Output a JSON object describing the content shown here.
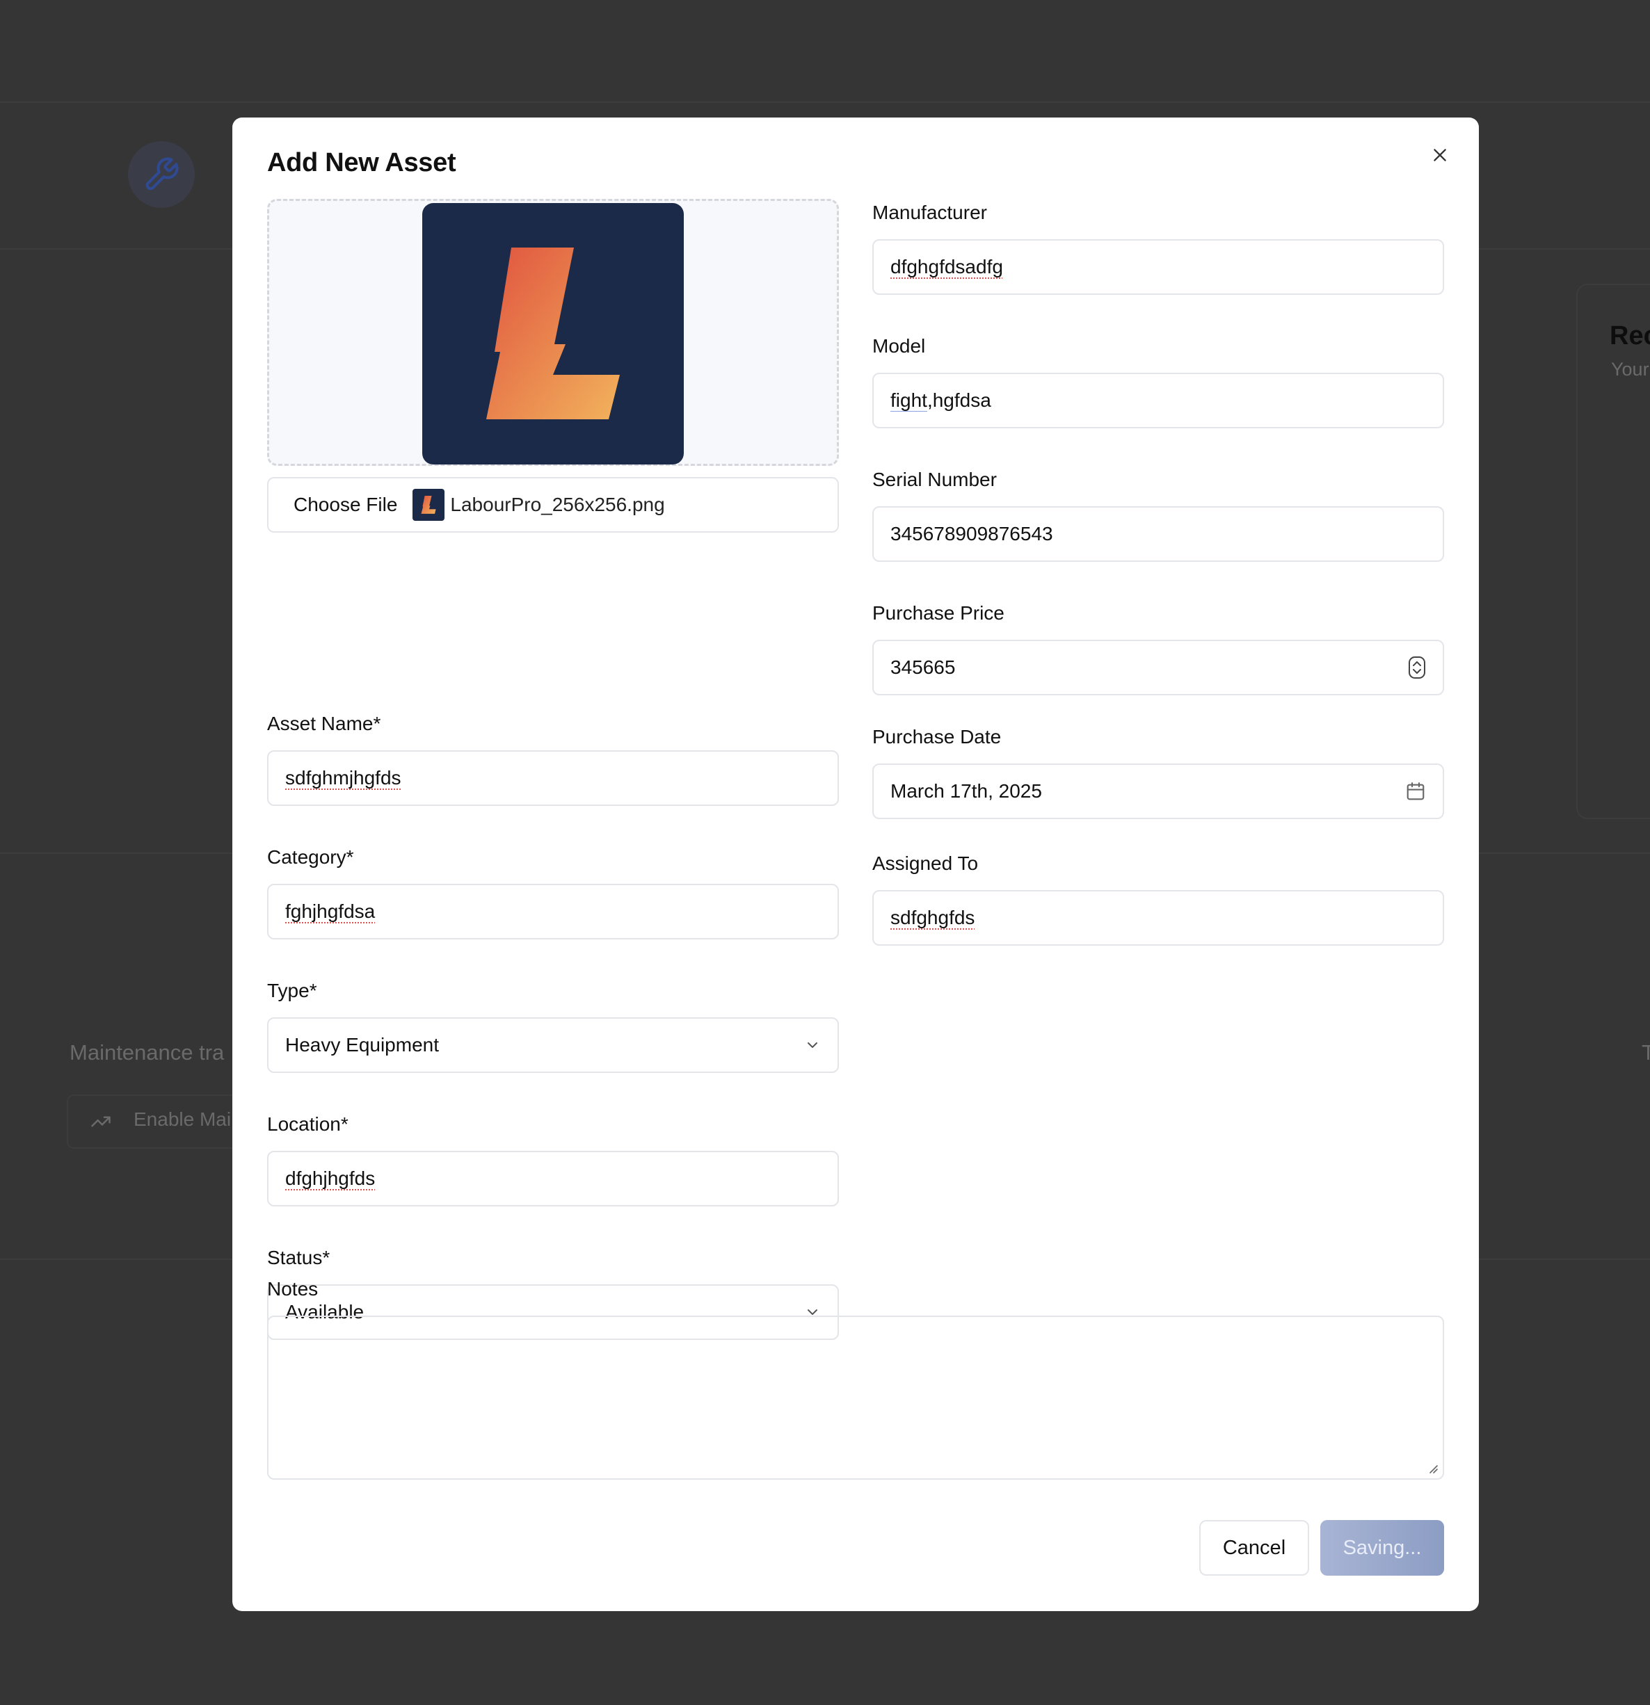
{
  "background": {
    "section_text": "Maintenance tra",
    "enable_button": "Enable Mai",
    "card_title": "Rec",
    "card_subtitle": "Your",
    "right_edge_char": "T"
  },
  "modal": {
    "title": "Add New Asset",
    "close_icon": "close-icon"
  },
  "image_upload": {
    "choose_file_label": "Choose File",
    "file_name": "LabourPro_256x256.png"
  },
  "fields": {
    "asset_name": {
      "label": "Asset Name*",
      "value": "sdfghmjhgfds"
    },
    "category": {
      "label": "Category*",
      "value": "fghjhgfdsa"
    },
    "type": {
      "label": "Type*",
      "value": "Heavy Equipment"
    },
    "location": {
      "label": "Location*",
      "value": "dfghjhgfds"
    },
    "status": {
      "label": "Status*",
      "value": "Available"
    },
    "manufacturer": {
      "label": "Manufacturer",
      "value": "dfghgfdsadfg"
    },
    "model": {
      "label": "Model",
      "value_underlined": "fight",
      "value_rest": ",hgfdsa"
    },
    "serial_number": {
      "label": "Serial Number",
      "value": "345678909876543"
    },
    "purchase_price": {
      "label": "Purchase Price",
      "value": "345665"
    },
    "purchase_date": {
      "label": "Purchase Date",
      "value": "March 17th, 2025"
    },
    "assigned_to": {
      "label": "Assigned To",
      "value": "sdfghgfds"
    },
    "notes": {
      "label": "Notes",
      "value": ""
    }
  },
  "actions": {
    "cancel": "Cancel",
    "save": "Saving..."
  },
  "colors": {
    "overlay": "#353535",
    "logo_bg": "#1b2a49",
    "logo_gradient_start": "#e0533f",
    "logo_gradient_end": "#f2b35c",
    "save_button": "#8c9dc4"
  }
}
